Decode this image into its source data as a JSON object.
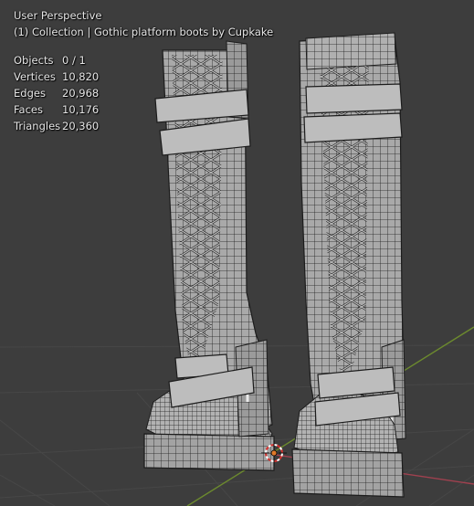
{
  "viewport": {
    "view_name": "User Perspective",
    "collection_line": "(1) Collection | Gothic platform boots by Cupkake",
    "colors": {
      "background": "#3d3d3d",
      "grid": "#474747",
      "axis_x": "#a0414f",
      "axis_y": "#6c8a2e",
      "mesh_fill": "#a9a9a9",
      "mesh_wire": "#1c1c1c",
      "cursor": "#e07a2a"
    }
  },
  "statistics": [
    {
      "label": "Objects",
      "value": "0 / 1"
    },
    {
      "label": "Vertices",
      "value": "10,820"
    },
    {
      "label": "Edges",
      "value": "20,968"
    },
    {
      "label": "Faces",
      "value": "10,176"
    },
    {
      "label": "Triangles",
      "value": "20,360"
    }
  ],
  "icons": {
    "cursor": "3d-cursor-icon"
  }
}
